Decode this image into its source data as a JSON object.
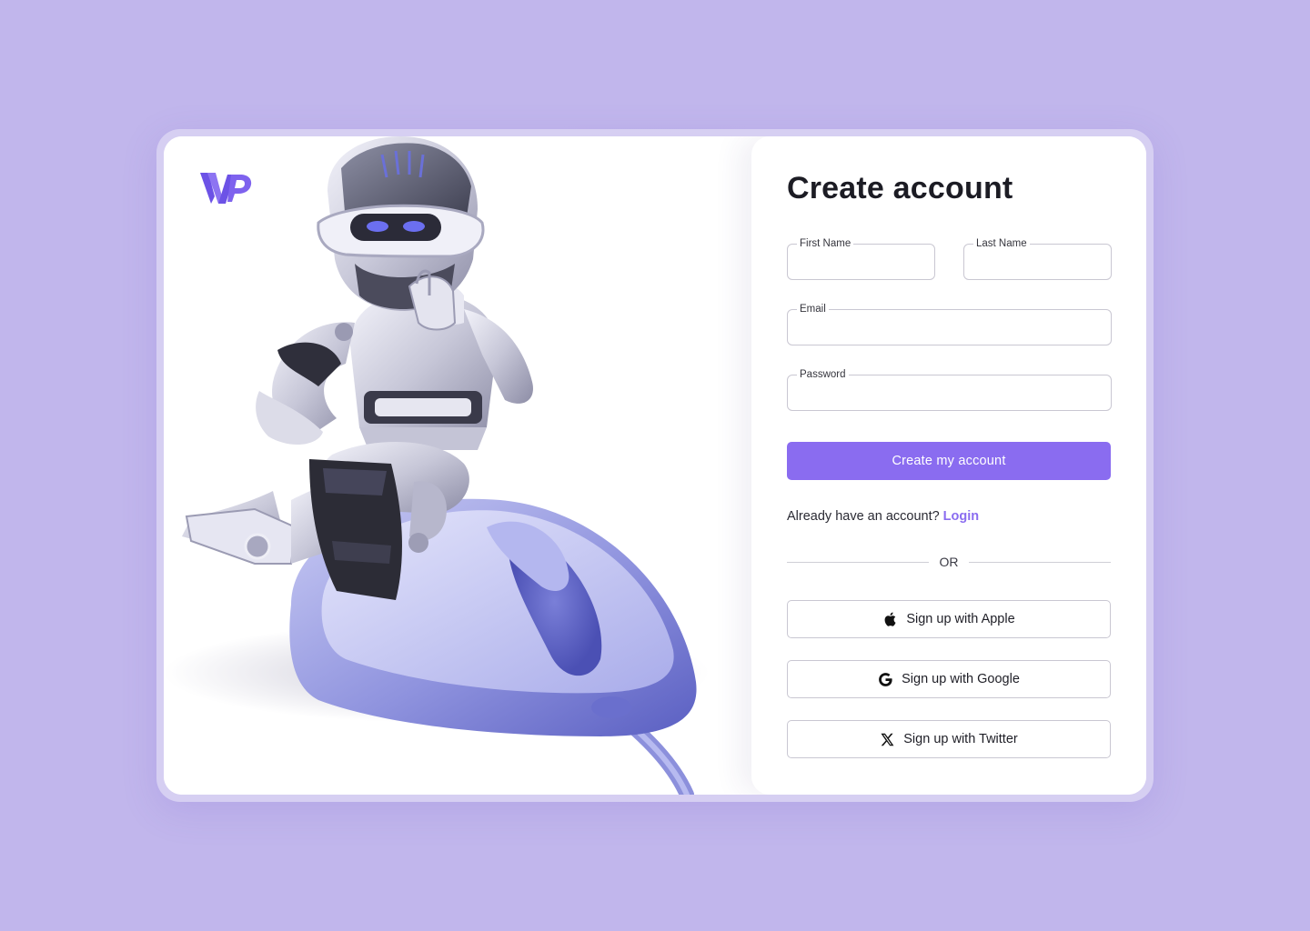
{
  "brand": {
    "logo_icon": "wp-logo-icon",
    "accent_color": "#8a6cf0"
  },
  "hero": {
    "illustration_icon": "robot-on-mouse-illustration"
  },
  "form": {
    "title": "Create account",
    "first_name": {
      "label": "First Name",
      "value": ""
    },
    "last_name": {
      "label": "Last Name",
      "value": ""
    },
    "email": {
      "label": "Email",
      "value": ""
    },
    "password": {
      "label": "Password",
      "value": ""
    },
    "submit_label": "Create my account",
    "login_prompt": "Already have an account?",
    "login_link": "Login",
    "divider_text": "OR"
  },
  "social": {
    "apple": {
      "label": "Sign up with Apple",
      "icon": "apple-icon"
    },
    "google": {
      "label": "Sign up with Google",
      "icon": "google-icon"
    },
    "twitter": {
      "label": "Sign up with Twitter",
      "icon": "x-twitter-icon"
    }
  }
}
